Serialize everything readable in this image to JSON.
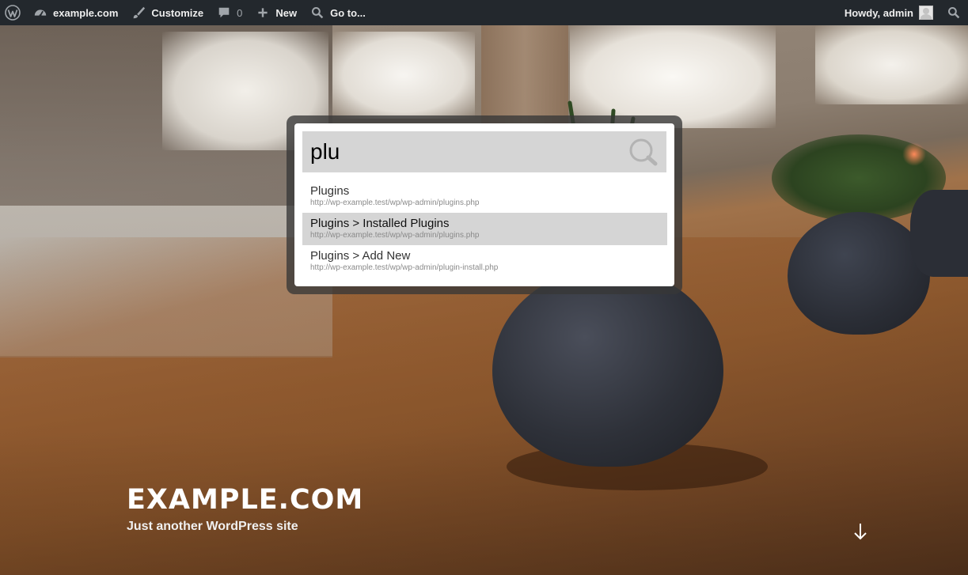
{
  "admin_bar": {
    "wp_logo_icon": "wordpress-icon",
    "site_name": "example.com",
    "site_icon": "dashboard-icon",
    "customize": "Customize",
    "customize_icon": "brush-icon",
    "comments_icon": "comment-bubble-icon",
    "comments_count": "0",
    "new": "New",
    "new_icon": "plus-icon",
    "goto": "Go to...",
    "goto_icon": "search-icon",
    "howdy": "Howdy, admin",
    "search_icon": "search-icon",
    "colors": {
      "bar": "#23282d",
      "text": "#eeeeee",
      "muted": "#a0a5aa"
    }
  },
  "spotlight": {
    "query": "plu",
    "search_icon": "magnifier-icon",
    "results": [
      {
        "title": "Plugins",
        "url": "http://wp-example.test/wp/wp-admin/plugins.php",
        "active": false
      },
      {
        "title": "Plugins > Installed Plugins",
        "url": "http://wp-example.test/wp/wp-admin/plugins.php",
        "active": true
      },
      {
        "title": "Plugins > Add New",
        "url": "http://wp-example.test/wp/wp-admin/plugin-install.php",
        "active": false
      }
    ],
    "colors": {
      "highlight": "#d5d5d5",
      "frame": "#373737"
    }
  },
  "site": {
    "title": "EXAMPLE.COM",
    "tagline": "Just another WordPress site",
    "scroll_icon": "arrow-down-icon"
  }
}
